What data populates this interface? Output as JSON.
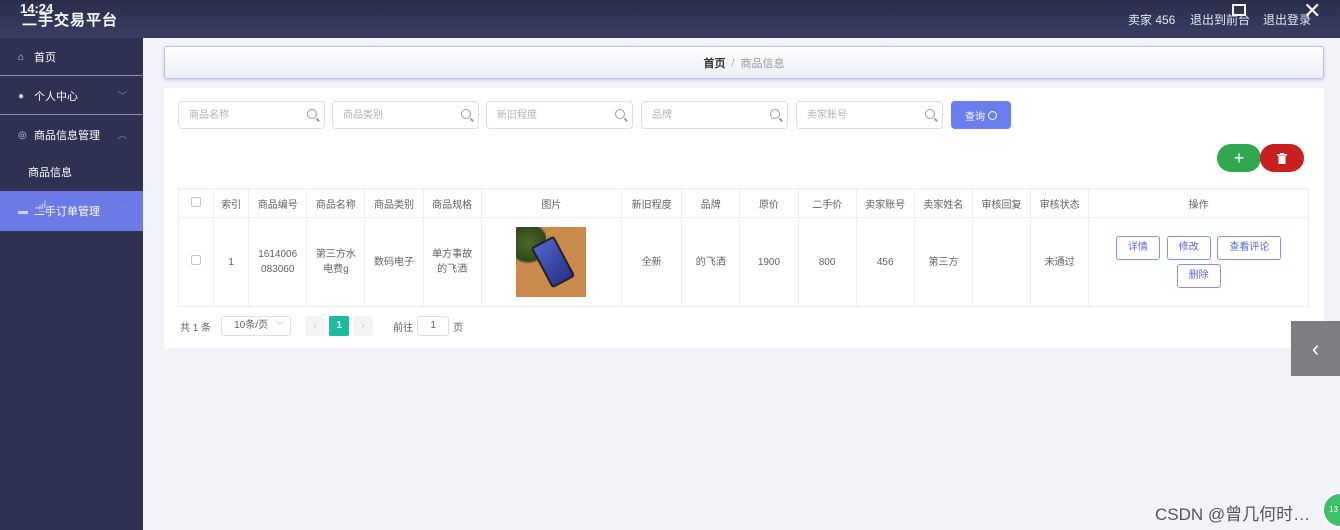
{
  "topbar": {
    "clock": "14:24",
    "title": "二手交易平台",
    "user_info": "卖家 456",
    "logout_front": "退出到前台",
    "logout": "退出登录"
  },
  "sidebar": {
    "items": [
      {
        "label": "首页",
        "icon": "home-icon"
      },
      {
        "label": "个人中心",
        "icon": "user-icon"
      },
      {
        "label": "商品信息管理",
        "icon": "goods-icon"
      },
      {
        "label": "商品信息",
        "icon": ""
      },
      {
        "label": "二手订单管理",
        "icon": "order-icon"
      }
    ]
  },
  "breadcrumb": {
    "home": "首页",
    "separator": "/",
    "current": "商品信息"
  },
  "search": {
    "placeholders": [
      "商品名称",
      "商品类别",
      "新旧程度",
      "品牌",
      "卖家账号"
    ],
    "query_label": "查询"
  },
  "actions": {
    "add_icon": "+",
    "delete_icon": "trash-icon"
  },
  "table": {
    "headers": [
      "索引",
      "商品编号",
      "商品名称",
      "商品类别",
      "商品规格",
      "图片",
      "新旧程度",
      "品牌",
      "原价",
      "二手价",
      "卖家账号",
      "卖家姓名",
      "审核回复",
      "审核状态",
      "操作"
    ],
    "rows": [
      {
        "index": "1",
        "code_line1": "1614006",
        "code_line2": "083060",
        "name_line1": "第三方水",
        "name_line2": "电费g",
        "category": "数码电子",
        "spec_line1": "单方事故",
        "spec_line2": "的飞洒",
        "condition": "全新",
        "brand": "的飞洒",
        "original_price": "1900",
        "second_price": "800",
        "seller_account": "456",
        "seller_name": "第三方",
        "review_reply": "",
        "review_status": "未通过"
      }
    ],
    "row_buttons": {
      "detail": "详情",
      "edit": "修改",
      "comments": "查看评论",
      "delete": "删除"
    }
  },
  "pager": {
    "total": "共 1 条",
    "page_size": "10条/页",
    "current_page": "1",
    "goto_label": "前往",
    "goto_value": "1",
    "page_unit": "页"
  },
  "watermark": "CSDN @曾几何时…",
  "badge": "13"
}
